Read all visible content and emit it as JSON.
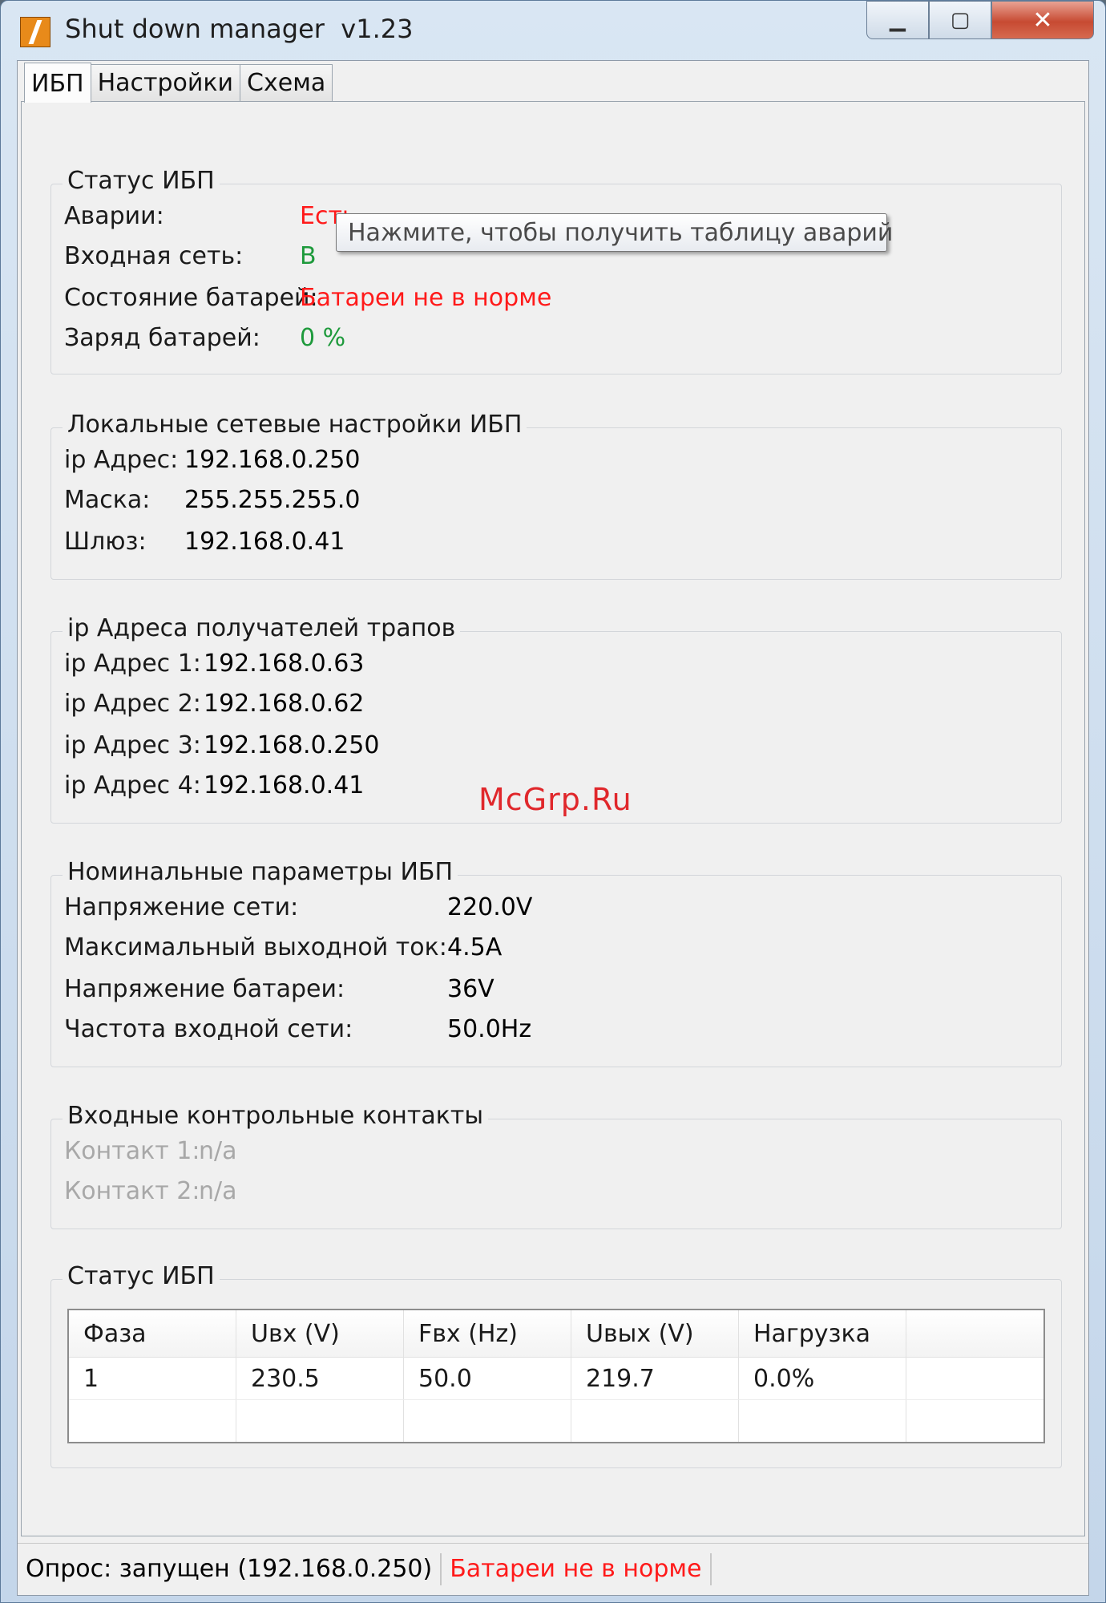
{
  "window": {
    "title": "Shut down manager  v1.23",
    "minimize": "▁",
    "maximize": "▢",
    "close": "✕"
  },
  "tabs": [
    {
      "label": "ИБП"
    },
    {
      "label": "Настройки"
    },
    {
      "label": "Схема"
    }
  ],
  "ups_status": {
    "title": "Статус ИБП",
    "alarms_label": "Аварии:",
    "alarms_value": "Есть",
    "input_label": "Входная сеть:",
    "input_value": "В",
    "battery_state_label": "Состояние батарей:",
    "battery_state_value": "Батареи не в норме",
    "charge_label": "Заряд батарей:",
    "charge_value": "0 %"
  },
  "tooltip": "Нажмите, чтобы получить таблицу аварий",
  "network": {
    "title": "Локальные сетевые настройки ИБП",
    "ip_label": "ip Адрес:",
    "ip_value": "192.168.0.250",
    "mask_label": "Маска:",
    "mask_value": "255.255.255.0",
    "gateway_label": "Шлюз:",
    "gateway_value": "192.168.0.41"
  },
  "traps": {
    "title": "ip Адреса получателей трапов",
    "items": [
      {
        "label": "ip Адрес 1:",
        "value": "192.168.0.63"
      },
      {
        "label": "ip Адрес 2:",
        "value": "192.168.0.62"
      },
      {
        "label": "ip Адрес 3:",
        "value": "192.168.0.250"
      },
      {
        "label": "ip Адрес 4:",
        "value": "192.168.0.41"
      }
    ]
  },
  "nominal": {
    "title": "Номинальные параметры ИБП",
    "items": [
      {
        "label": "Напряжение сети:",
        "value": "220.0V"
      },
      {
        "label": "Максимальный выходной ток:",
        "value": "4.5A"
      },
      {
        "label": "Напряжение батареи:",
        "value": "36V"
      },
      {
        "label": "Частота входной сети:",
        "value": "50.0Hz"
      }
    ]
  },
  "contacts": {
    "title": "Входные контрольные контакты",
    "items": [
      {
        "label": "Контакт 1:",
        "value": "n/a"
      },
      {
        "label": "Контакт 2:",
        "value": "n/a"
      }
    ]
  },
  "phase_table": {
    "title": "Статус ИБП",
    "headers": [
      "Фаза",
      "Uвх (V)",
      "Fвх (Hz)",
      "Uвых (V)",
      "Нагрузка"
    ],
    "rows": [
      [
        "1",
        "230.5",
        "50.0",
        "219.7",
        "0.0%"
      ]
    ]
  },
  "watermark": "McGrp.Ru",
  "statusbar": {
    "poll": "Опрос: запущен (192.168.0.250)",
    "alert": "Батареи не в норме"
  },
  "colors": {
    "alarm": "#ff1a1a",
    "ok": "#1e9a3c",
    "disabled": "#a8a8a8"
  }
}
